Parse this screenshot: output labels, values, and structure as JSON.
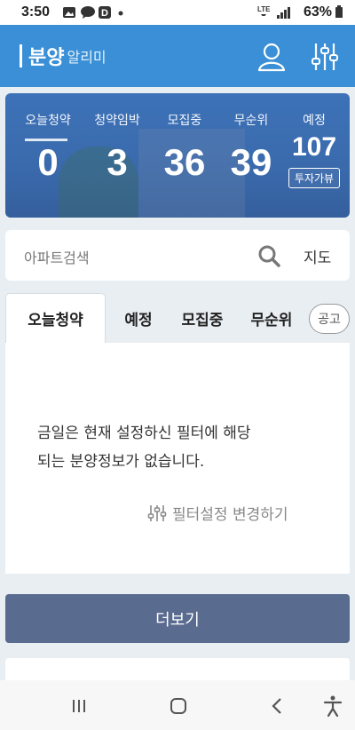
{
  "status_bar": {
    "time": "3:50",
    "battery": "63%",
    "network": "LTE"
  },
  "header": {
    "logo_main": "분양",
    "logo_sub": "알리미",
    "profile_icon": "user-icon",
    "filter_icon": "sliders-icon"
  },
  "stats": {
    "items": [
      {
        "label": "오늘청약",
        "value": "0"
      },
      {
        "label": "청약임박",
        "value": "3"
      },
      {
        "label": "모집중",
        "value": "36"
      },
      {
        "label": "무순위",
        "value": "39"
      },
      {
        "label": "예정",
        "value": "107"
      }
    ],
    "invest_label": "투자가뷰"
  },
  "search": {
    "placeholder": "아파트검색",
    "map_label": "지도"
  },
  "tabs": [
    {
      "label": "오늘청약",
      "active": true
    },
    {
      "label": "예정",
      "active": false
    },
    {
      "label": "모집중",
      "active": false
    },
    {
      "label": "무순위",
      "active": false
    },
    {
      "label": "공고",
      "active": false
    }
  ],
  "content": {
    "empty_line1": "금일은 현재 설정하신 필터에 해당",
    "empty_line2": "되는 분양정보가 없습니다.",
    "filter_link": "필터설정 변경하기"
  },
  "more_label": "더보기",
  "colors": {
    "header": "#3a8fd6",
    "stats_bg": "#3a6aac",
    "more_button": "#5a6b90",
    "page_bg": "#e9eef2"
  }
}
